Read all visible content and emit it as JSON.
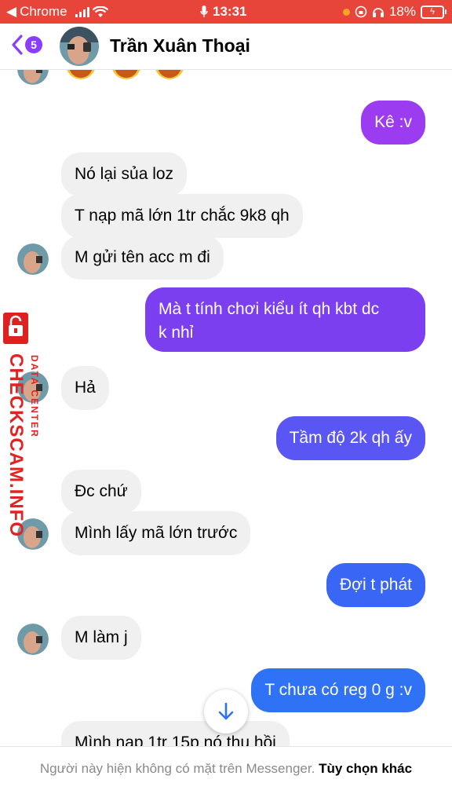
{
  "status_bar": {
    "back_app": "Chrome",
    "time": "13:31",
    "battery": "18%"
  },
  "header": {
    "back_badge": "5",
    "contact_name": "Trần Xuân Thoại"
  },
  "messages": [
    {
      "side": "out",
      "text": "Kê :v"
    },
    {
      "side": "in",
      "text": "Nó lại sủa loz"
    },
    {
      "side": "in",
      "text": "T nạp mã lớn 1tr chắc 9k8 qh"
    },
    {
      "side": "in",
      "text": "M gửi tên acc m đi"
    },
    {
      "side": "out",
      "text": "Mà t tính chơi kiểu ít qh kbt dc",
      "text2": "k nhỉ"
    },
    {
      "side": "in",
      "text": "Hả"
    },
    {
      "side": "out",
      "text": "Tầm độ 2k qh ấy"
    },
    {
      "side": "in",
      "text": "Đc chứ"
    },
    {
      "side": "in",
      "text": "Mình lấy mã lớn trước"
    },
    {
      "side": "out",
      "text": "Đợi t phát"
    },
    {
      "side": "in",
      "text": "M làm j"
    },
    {
      "side": "out",
      "text": "T chưa có reg 0 g :v"
    },
    {
      "side": "in",
      "text": "Mình nạp 1tr 15p nó thu hồi"
    }
  ],
  "watermark": {
    "main": "CHECKSCAM.INFO",
    "sub": "DATA CENTER"
  },
  "footer": {
    "notice": "Người này hiện không có mặt trên Messenger.",
    "link": "Tùy chọn khác"
  },
  "colors": {
    "status_bar": "#e8453a",
    "bubble_in": "#f0f0f0",
    "accent_purple": "#8b3dff",
    "bubble_out_top": "#9b3cf0",
    "bubble_out_bottom": "#2f72f5"
  }
}
